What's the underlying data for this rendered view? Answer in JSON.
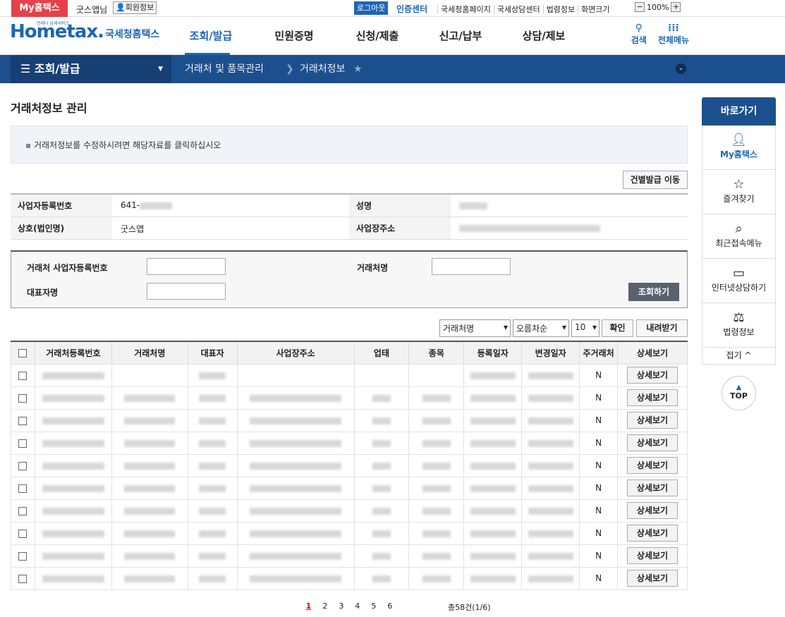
{
  "util": {
    "my_tag": "My홈택스",
    "user_name": "굿스앱님",
    "member_info": "회원정보",
    "logout": "로그아웃",
    "auth_center": "인증센터",
    "links": [
      "국세청홈페이지",
      "국세상담센터",
      "법령정보",
      "화면크기"
    ],
    "zoom_minus": "−",
    "zoom_value": "100%",
    "zoom_plus": "+"
  },
  "header": {
    "logo_sub": "언제나 납세서비스",
    "logo_main": "Hometax.",
    "logo_kr": "국세청홈택스",
    "menu": [
      "조회/발급",
      "민원증명",
      "신청/제출",
      "신고/납부",
      "상담/제보"
    ],
    "search": "검색",
    "all_menu": "전체메뉴"
  },
  "navbar": {
    "first": "조회/발급",
    "crumb1": "거래처 및 품목관리",
    "crumb2": "거래처정보"
  },
  "page": {
    "title": "거래처정보 관리",
    "notice": "거래처정보를 수정하시려면 해당자료를 클릭하십시오",
    "jump_button": "건별발급 이동"
  },
  "info": {
    "biz_no_label": "사업자등록번호",
    "biz_no_value": "641-",
    "name_label": "성명",
    "company_label": "상호(법인명)",
    "company_value": "굿스앱",
    "address_label": "사업장주소"
  },
  "search": {
    "partner_biz_no_label": "거래처 사업자등록번호",
    "partner_name_label": "거래처명",
    "rep_name_label": "대표자명",
    "search_button": "조회하기"
  },
  "controls": {
    "sort_field": "거래처명",
    "sort_order": "오름차순",
    "page_size": "10",
    "confirm": "확인",
    "download": "내려받기"
  },
  "table": {
    "headers": [
      "거래처등록번호",
      "거래처명",
      "대표자",
      "사업장주소",
      "업태",
      "종목",
      "등록일자",
      "변경일자",
      "주거래처",
      "상세보기"
    ],
    "rows": [
      {
        "main": "N",
        "detail": "상세보기"
      },
      {
        "main": "N",
        "detail": "상세보기"
      },
      {
        "main": "N",
        "detail": "상세보기"
      },
      {
        "main": "N",
        "detail": "상세보기"
      },
      {
        "main": "N",
        "detail": "상세보기"
      },
      {
        "main": "N",
        "detail": "상세보기"
      },
      {
        "main": "N",
        "detail": "상세보기"
      },
      {
        "main": "N",
        "detail": "상세보기"
      },
      {
        "main": "N",
        "detail": "상세보기"
      },
      {
        "main": "N",
        "detail": "상세보기"
      }
    ]
  },
  "pager": {
    "pages": [
      "1",
      "2",
      "3",
      "4",
      "5",
      "6"
    ],
    "total": "총58건(1/6)"
  },
  "quick": {
    "title": "바로가기",
    "items": [
      "My홈택스",
      "즐겨찾기",
      "최근접속메뉴",
      "인터넷상담하기",
      "법령정보"
    ],
    "fold": "접기 ^",
    "top": "TOP"
  }
}
